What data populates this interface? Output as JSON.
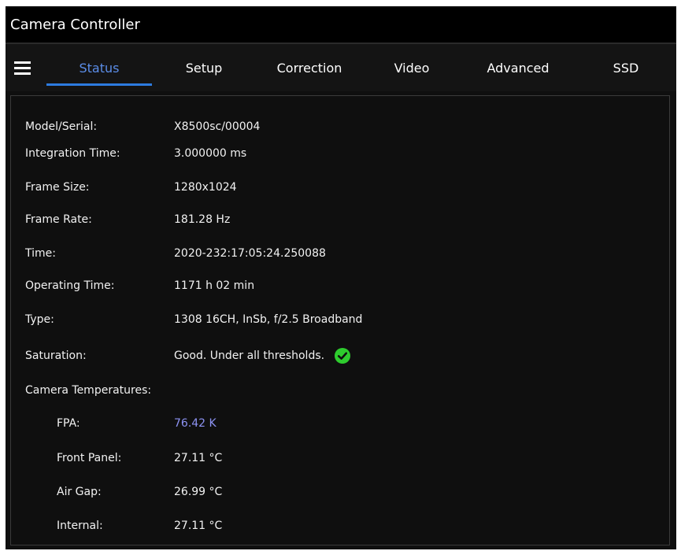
{
  "app": {
    "title": "Camera Controller"
  },
  "nav": {
    "menu_icon": "hamburger-menu-icon",
    "tabs": [
      {
        "label": "Status",
        "active": true
      },
      {
        "label": "Setup",
        "active": false
      },
      {
        "label": "Correction",
        "active": false
      },
      {
        "label": "Video",
        "active": false
      },
      {
        "label": "Advanced",
        "active": false
      },
      {
        "label": "SSD",
        "active": false
      }
    ],
    "accent_color": "#2d7be0"
  },
  "status": {
    "model_serial": {
      "label": "Model/Serial:",
      "value": "X8500sc/00004"
    },
    "integration_time": {
      "label": "Integration Time:",
      "value": "3.000000 ms"
    },
    "frame_size": {
      "label": "Frame Size:",
      "value": "1280x1024"
    },
    "frame_rate": {
      "label": "Frame Rate:",
      "value": "181.28 Hz"
    },
    "time": {
      "label": "Time:",
      "value": "2020-232:17:05:24.250088"
    },
    "operating_time": {
      "label": "Operating Time:",
      "value": "1171 h 02 min"
    },
    "type": {
      "label": "Type:",
      "value": "1308 16CH, InSb, f/2.5 Broadband"
    },
    "saturation": {
      "label": "Saturation:",
      "value": "Good. Under all thresholds.",
      "icon": "check-circle-icon",
      "icon_color": "#2ecc2e"
    },
    "temperatures_heading": "Camera Temperatures:",
    "fpa": {
      "label": "FPA:",
      "value": "76.42 K",
      "color": "#8d93f3"
    },
    "front_panel": {
      "label": "Front Panel:",
      "value": "27.11 °C"
    },
    "air_gap": {
      "label": "Air Gap:",
      "value": "26.99 °C"
    },
    "internal": {
      "label": "Internal:",
      "value": "27.11 °C"
    }
  }
}
